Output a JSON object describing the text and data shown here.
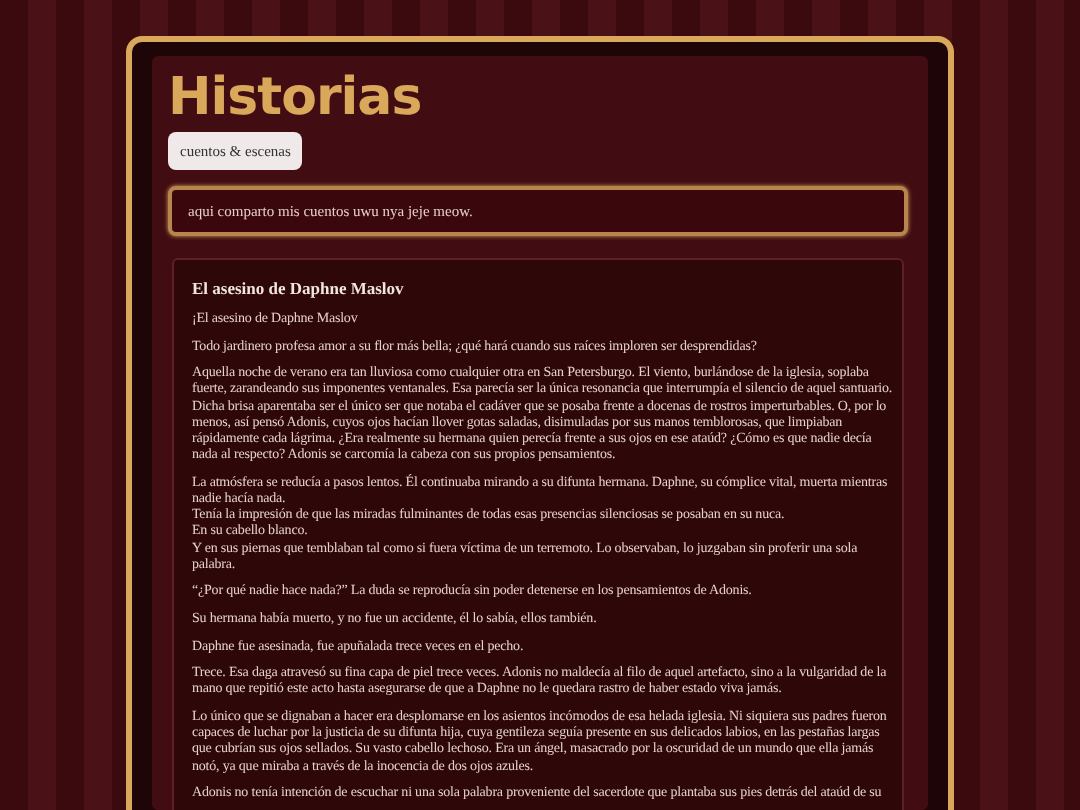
{
  "header": {
    "title": "Historias",
    "tag": "cuentos & escenas"
  },
  "description": "aqui comparto mis cuentos uwu nya jeje meow.",
  "story": {
    "title": "El asesino de Daphne Maslov",
    "paragraphs": [
      "¡El asesino de Daphne Maslov",
      "Todo jardinero profesa amor a su flor más bella; ¿qué hará cuando sus raíces imploren ser desprendidas?",
      "Aquella noche de verano era tan lluviosa como cualquier otra en San Petersburgo. El viento, burlándose de la iglesia, soplaba fuerte, zarandeando sus imponentes ventanales. Esa parecía ser la única resonancia que interrumpía el silencio de aquel santuario. Dicha brisa aparentaba ser el único ser que notaba el cadáver que se posaba frente a docenas de rostros imperturbables. O, por lo menos, así pensó Adonis, cuyos ojos hacían llover gotas saladas, disimuladas por sus manos temblorosas, que limpiaban rápidamente cada lágrima. ¿Era realmente su hermana quien perecía frente a sus ojos en ese ataúd? ¿Cómo es que nadie decía nada al respecto? Adonis se carcomía la cabeza con sus propios pensamientos.",
      "La atmósfera se reducía a pasos lentos. Él continuaba mirando a su difunta hermana. Daphne, su cómplice vital, muerta mientras nadie hacía nada.\nTenía la impresión de que las miradas fulminantes de todas esas presencias silenciosas se posaban en su nuca.\nEn su cabello blanco.\nY en sus piernas que temblaban tal como si fuera víctima de un terremoto. Lo observaban, lo juzgaban sin proferir una sola palabra.",
      "“¿Por qué nadie hace nada?” La duda se reproducía sin poder detenerse en los pensamientos de Adonis.",
      "Su hermana había muerto, y no fue un accidente, él lo sabía, ellos también.",
      "Daphne fue asesinada, fue apuñalada trece veces en el pecho.",
      "Trece. Esa daga atravesó su fina capa de piel trece veces. Adonis no maldecía al filo de aquel artefacto, sino a la vulgaridad de la mano que repitió este acto hasta asegurarse de que a Daphne no le quedara rastro de haber estado viva jamás.",
      "Lo único que se dignaban a hacer era desplomarse en los asientos incómodos de esa helada iglesia. Ni siquiera sus padres fueron capaces de luchar por la justicia de su difunta hija, cuya gentileza seguía presente en sus delicados labios, en las pestañas largas que cubrían sus ojos sellados. Su vasto cabello lechoso. Era un ángel, masacrado por la oscuridad de un mundo que ella jamás notó, ya que miraba a través de la inocencia de dos ojos azules.",
      "Adonis no tenía intención de escuchar ni una sola palabra proveniente del sacerdote que plantaba sus pies detrás del ataúd de su"
    ]
  }
}
